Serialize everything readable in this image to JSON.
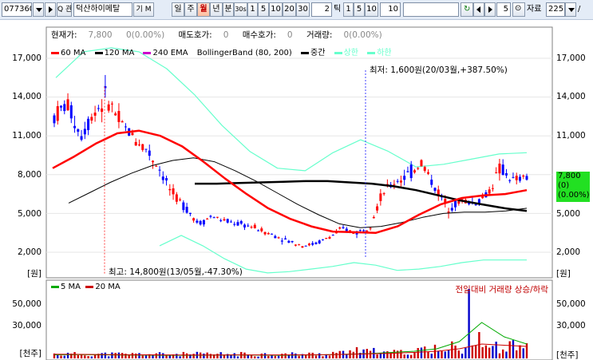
{
  "toolbar": {
    "code": "077360",
    "name": "덕산하이메탈",
    "period_tabs": [
      "일",
      "주",
      "월",
      "년",
      "분",
      "30s",
      "1",
      "5",
      "10",
      "20",
      "30"
    ],
    "active_period": "월",
    "tick_value": "2",
    "tick_label": "틱",
    "tick_tabs": [
      "1",
      "5",
      "10"
    ],
    "tick_field": "10",
    "zoom_value": "5",
    "data_label": "자료",
    "count_value": "225",
    "slash": "/",
    "btn_search": "Q 관",
    "btn_gm": "기 M"
  },
  "info": {
    "current_price_label": "현재가:",
    "current_price": "7,800",
    "change": "0(0.00%)",
    "ask_label": "매도호가:",
    "ask": "0",
    "bid_label": "매수호가:",
    "bid": "0",
    "volume_label": "거래량:",
    "volume": "0(0.00%)"
  },
  "legend": [
    {
      "label": "60 MA",
      "color": "#ff0000"
    },
    {
      "label": "120 MA",
      "color": "#000000"
    },
    {
      "label": "240 EMA",
      "color": "#cc00cc"
    },
    {
      "label": "BollingerBand (80, 200)",
      "color": "#000000"
    },
    {
      "label": "중간",
      "color": "#000000"
    },
    {
      "label": "상한",
      "color": "#66ffcc"
    },
    {
      "label": "하한",
      "color": "#66ffcc"
    }
  ],
  "price_axis": {
    "labels": [
      "17,000",
      "14,000",
      "11,000",
      "8,000",
      "5,000",
      "2,000"
    ],
    "unit": "[원]"
  },
  "volume_axis": {
    "labels": [
      "50,000",
      "30,000"
    ],
    "unit": "[천주]"
  },
  "volume_legend": [
    {
      "label": "5 MA",
      "color": "#00aa00"
    },
    {
      "label": "20 MA",
      "color": "#cc0000"
    }
  ],
  "volume_note": "전일대비 거래량 상승/하락",
  "annotations": {
    "low": "최저: 1,600원(20/03월,+387.50%)",
    "high": "최고: 14,800원(13/05월,-47.30%)"
  },
  "price_box": {
    "price": "7,800",
    "change": "(0)",
    "pct": "(0.00%)",
    "color": "#22e022"
  },
  "colors": {
    "up": "#ff0000",
    "down": "#0000ff",
    "ma60": "#ff0000",
    "ma120": "#000000",
    "band": "#66ffcc",
    "middle": "#000000"
  },
  "chart_data": {
    "type": "candlestick",
    "title": "",
    "xlabel": "",
    "ylabel": "[원]",
    "ylim": [
      0,
      18000
    ],
    "series": [
      {
        "name": "60 MA",
        "values": [
          8500,
          9400,
          10400,
          11200,
          11400,
          11000,
          10200,
          9000,
          7700,
          6500,
          5400,
          4600,
          4000,
          3600,
          3550,
          3500,
          4000,
          4900,
          5700,
          6200,
          6400,
          6500,
          6800
        ]
      },
      {
        "name": "120 MA",
        "values": [
          5800,
          6600,
          7400,
          8100,
          8700,
          9100,
          9300,
          9000,
          8300,
          7500,
          6600,
          5700,
          4900,
          4200,
          3900,
          4000,
          4300,
          4700,
          5000,
          5100,
          5100,
          5200,
          5400
        ]
      },
      {
        "name": "중간",
        "values": [
          7300,
          7300,
          7350,
          7400,
          7450,
          7500,
          7500,
          7400,
          7300,
          7100,
          6800,
          6400,
          6000,
          5700,
          5400,
          5200
        ]
      },
      {
        "name": "상한",
        "values": [
          15500,
          17500,
          17800,
          17500,
          16200,
          14200,
          11800,
          9800,
          8500,
          8300,
          9700,
          10700,
          9800,
          8600,
          8800,
          9200,
          9600,
          9700
        ]
      },
      {
        "name": "하한",
        "values": [
          2500,
          3300,
          2500,
          1500,
          700,
          400,
          500,
          700,
          900,
          1200,
          1000,
          600,
          700,
          900,
          1200,
          1400,
          1400,
          1400
        ]
      }
    ],
    "volume_series": [
      {
        "name": "5 MA"
      },
      {
        "name": "20 MA"
      }
    ],
    "volume_ylim": [
      0,
      60000
    ],
    "annotations": [
      {
        "text": "최고: 14,800원(13/05월,-47.30%)",
        "value": 14800
      },
      {
        "text": "최저: 1,600원(20/03월,+387.50%)",
        "value": 1600
      }
    ]
  }
}
